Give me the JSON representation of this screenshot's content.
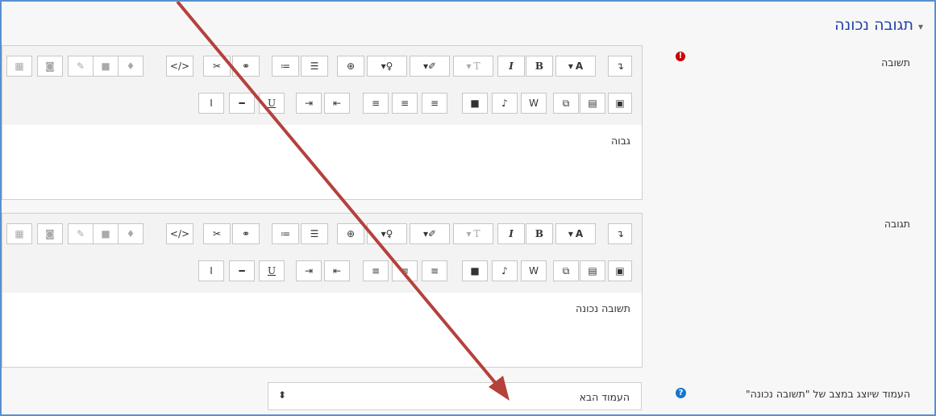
{
  "section": {
    "title": "תגובה נכונה"
  },
  "answer": {
    "label": "תשובה",
    "text": "גבוה"
  },
  "feedback": {
    "label": "תגובה",
    "text": "תשובה נכונה"
  },
  "page_select": {
    "label": "העמוד שיוצג במצב של \"תשובה נכונה\"",
    "value": "העמוד הבא"
  },
  "toolbar": {
    "bold": "B",
    "italic": "I",
    "underline": "U",
    "font_color": "A",
    "html": "</>",
    "font_size": "T"
  },
  "icons": {
    "required": "exclamation-circle-icon",
    "help": "question-circle-icon",
    "collapse": "chevron-down-icon",
    "select": "updown-arrows-icon"
  },
  "colors": {
    "accent": "#1f3fa8",
    "arrow": "#b5413b",
    "required": "#cc0000",
    "help": "#1177d1"
  }
}
